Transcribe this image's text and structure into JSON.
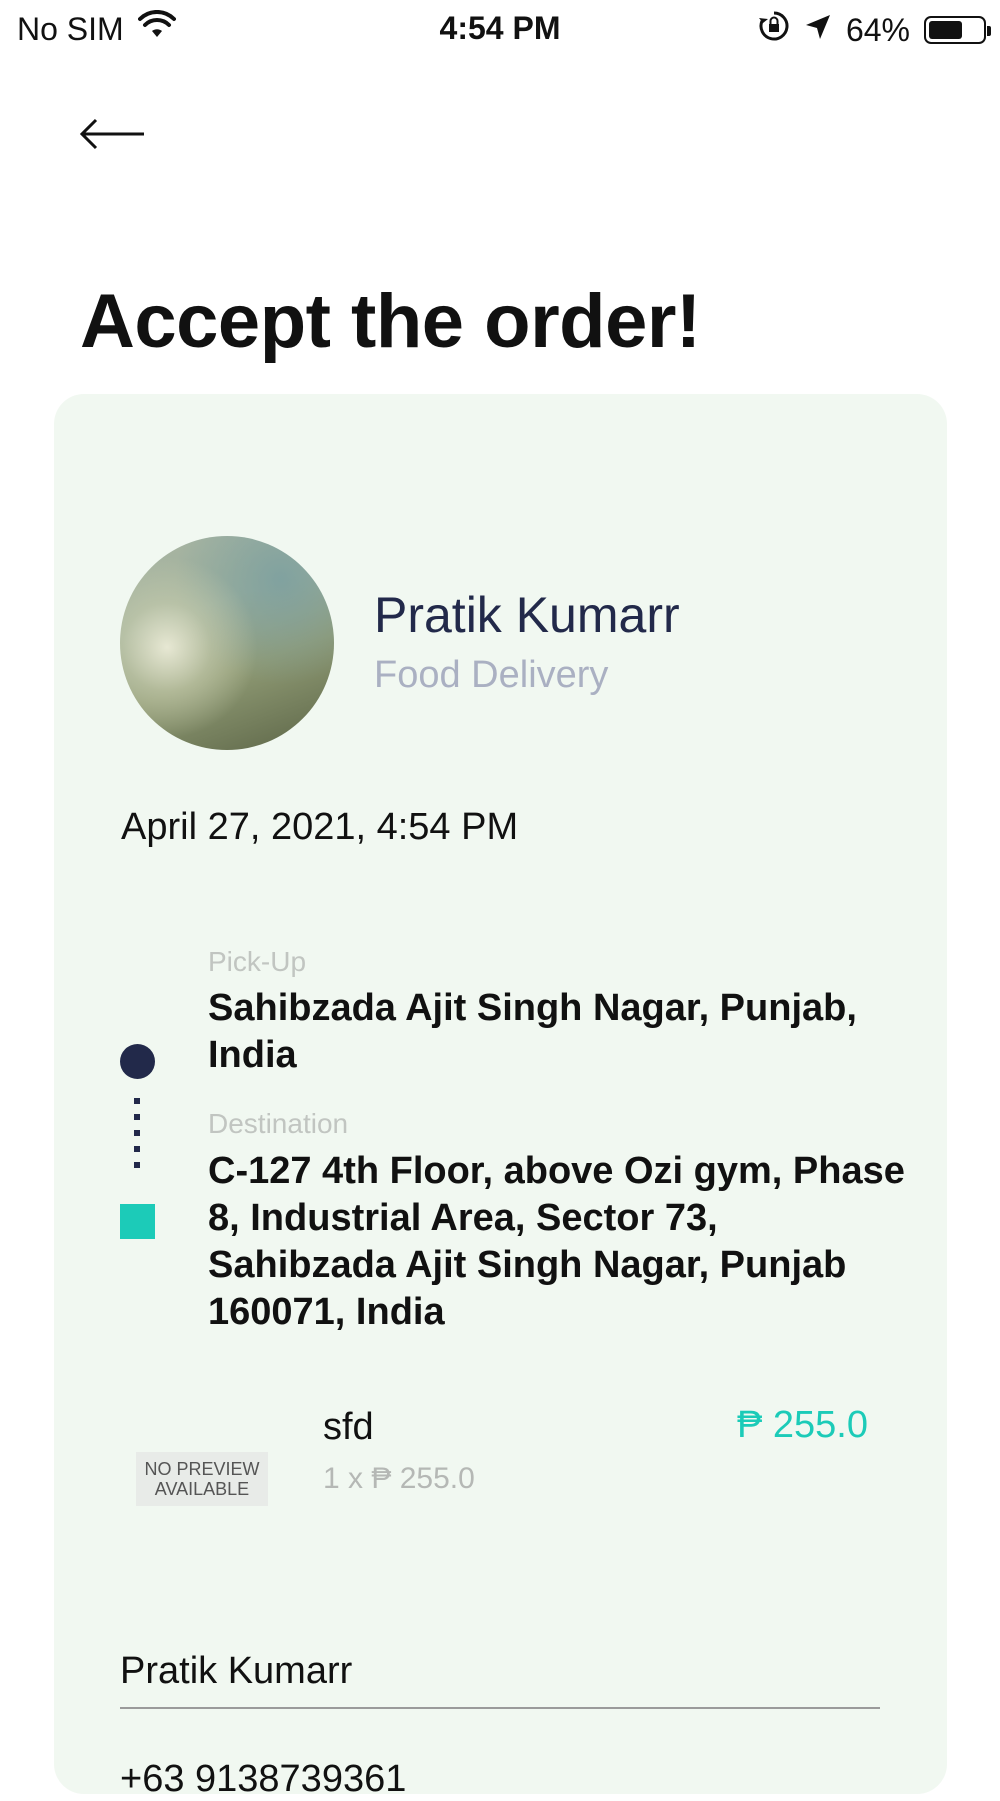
{
  "status_bar": {
    "carrier": "No SIM",
    "time": "4:54 PM",
    "battery_percent": "64%",
    "battery_level": 0.64,
    "icons": [
      "wifi-icon",
      "rotation-lock-icon",
      "location-arrow-icon",
      "battery-icon"
    ]
  },
  "header": {
    "back_icon": "arrow-left-icon",
    "title": "Accept the order!"
  },
  "order": {
    "customer_name": "Pratik Kumarr",
    "service_type": "Food Delivery",
    "datetime": "April 27, 2021, 4:54 PM",
    "pickup": {
      "label": "Pick-Up",
      "address": "Sahibzada Ajit Singh Nagar, Punjab, India"
    },
    "destination": {
      "label": "Destination",
      "address": "C-127 4th Floor, above Ozi gym, Phase 8, Industrial Area, Sector 73, Sahibzada Ajit Singh Nagar, Punjab 160071, India"
    },
    "items": [
      {
        "preview_text_line1": "NO PREVIEW",
        "preview_text_line2": "AVAILABLE",
        "name": "sfd",
        "quantity_price": "1 x ₱ 255.0",
        "total": "₱ 255.0"
      }
    ],
    "contact": {
      "name": "Pratik Kumarr",
      "phone": "+63 9138739361"
    }
  },
  "colors": {
    "card_background": "#f1f8f1",
    "navy": "#22294a",
    "accent_teal": "#1ccbb8"
  }
}
